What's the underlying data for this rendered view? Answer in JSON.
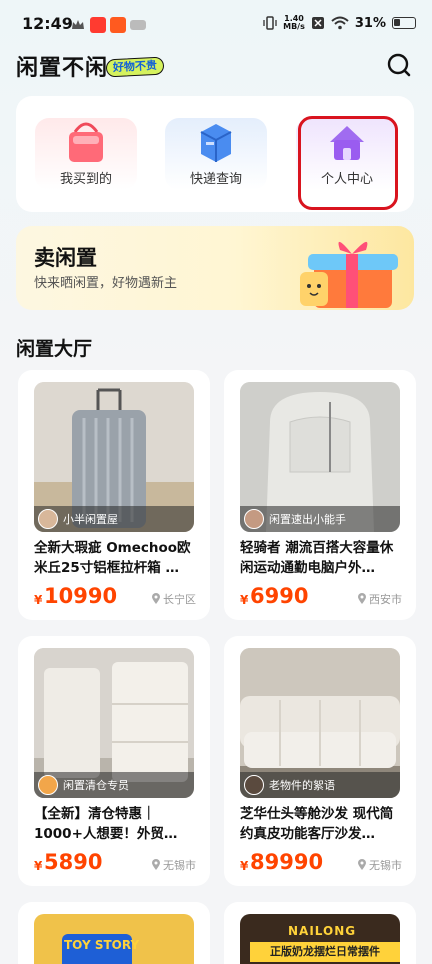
{
  "status_bar": {
    "time": "12:49",
    "net_speed_top": "1.40",
    "net_speed_bottom": "MB/s",
    "battery": "31%"
  },
  "header": {
    "title": "闲置不闲",
    "slogan": "好物不贵"
  },
  "shortcuts": [
    {
      "label": "我买到的",
      "icon": "shopping-bag-icon"
    },
    {
      "label": "快递查询",
      "icon": "package-icon"
    },
    {
      "label": "个人中心",
      "icon": "home-icon"
    }
  ],
  "sell_banner": {
    "title": "卖闲置",
    "subtitle": "快来晒闲置，好物遇新主"
  },
  "hall": {
    "title": "闲置大厅"
  },
  "products": [
    {
      "seller": "小半闲置屋",
      "title": "全新大瑕疵 Omechoo欧米丘25寸铝框拉杆箱 …",
      "currency": "¥",
      "price": "10990",
      "location": "长宁区"
    },
    {
      "seller": "闲置速出小能手",
      "title": "轻骑者 潮流百搭大容量休闲运动通勤电脑户外…",
      "currency": "¥",
      "price": "6990",
      "location": "西安市"
    },
    {
      "seller": "闲置清仓专员",
      "title": "【全新】清仓特惠｜1000+人想要！外贸…",
      "currency": "¥",
      "price": "5890",
      "location": "无锡市"
    },
    {
      "seller": "老物件的絮语",
      "title": "芝华仕头等舱沙发 现代简约真皮功能客厅沙发…",
      "currency": "¥",
      "price": "89990",
      "location": "无锡市"
    }
  ],
  "partial_cards": [
    {
      "text": "TOY STORY"
    },
    {
      "text": "NAILONG",
      "subtext": "正版奶龙摆烂日常摆件"
    }
  ],
  "colors": {
    "price": "#ff4400",
    "highlight": "#d9141f",
    "badge": "#d5f25e"
  }
}
